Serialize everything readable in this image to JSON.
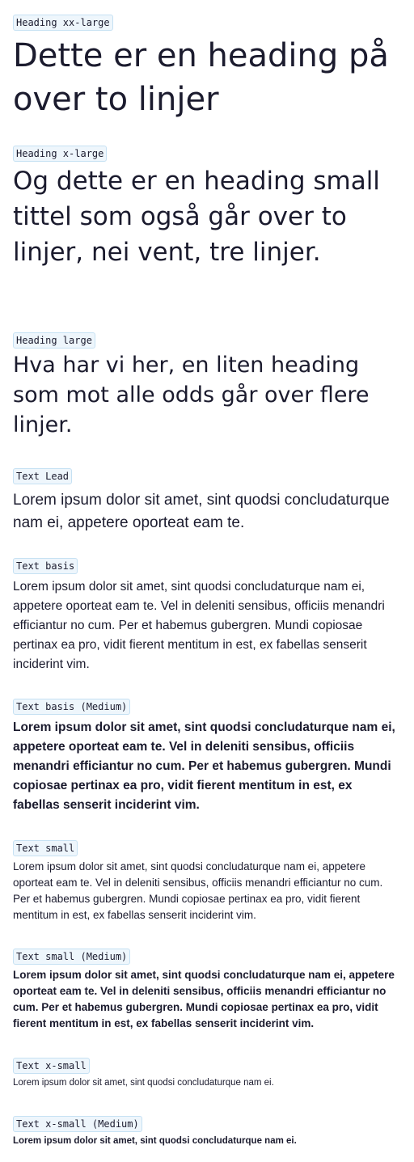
{
  "samples": {
    "heading_xxl": {
      "tag": "Heading xx-large",
      "text": "Dette er en heading på over to linjer"
    },
    "heading_xl": {
      "tag": "Heading x-large",
      "text": "Og dette er en heading small tittel som også går over to linjer, nei vent, tre linjer."
    },
    "heading_large": {
      "tag": "Heading large",
      "text": "Hva har vi her, en liten heading som mot alle odds går over flere linjer."
    },
    "text_lead": {
      "tag": "Text Lead",
      "text": "Lorem ipsum dolor sit amet, sint quodsi concludaturque nam ei, appetere oporteat eam te."
    },
    "text_basis": {
      "tag": "Text basis",
      "text": "Lorem ipsum dolor sit amet, sint quodsi concludaturque nam ei, appetere oporteat eam te. Vel in deleniti sensibus, officiis menandri efficiantur no cum. Per et habemus gubergren. Mundi copiosae pertinax ea pro, vidit fierent mentitum in est, ex fabellas senserit inciderint vim."
    },
    "text_basis_medium": {
      "tag": "Text basis (Medium)",
      "text": "Lorem ipsum dolor sit amet, sint quodsi concludaturque nam ei, appetere oporteat eam te. Vel in deleniti sensibus, officiis menandri efficiantur no cum. Per et habemus gubergren. Mundi copiosae pertinax ea pro, vidit fierent mentitum in est, ex fabellas senserit inciderint vim."
    },
    "text_small": {
      "tag": "Text small",
      "text": "Lorem ipsum dolor sit amet, sint quodsi concludaturque nam ei, appetere oporteat eam te. Vel in deleniti sensibus, officiis menandri efficiantur no cum. Per et habemus gubergren. Mundi copiosae pertinax ea pro, vidit fierent mentitum in est, ex fabellas senserit inciderint vim."
    },
    "text_small_medium": {
      "tag": "Text small (Medium)",
      "text": "Lorem ipsum dolor sit amet, sint quodsi concludaturque nam ei, appetere oporteat eam te. Vel in deleniti sensibus, officiis menandri efficiantur no cum. Per et habemus gubergren. Mundi copiosae pertinax ea pro, vidit fierent mentitum in est, ex fabellas senserit inciderint vim."
    },
    "text_xsmall": {
      "tag": "Text x-small",
      "text": "Lorem ipsum dolor sit amet, sint quodsi concludaturque nam ei."
    },
    "text_xsmall_medium": {
      "tag": "Text x-small (Medium)",
      "text": "Lorem ipsum dolor sit amet, sint quodsi concludaturque nam ei."
    }
  },
  "colors": {
    "text": "#1b1b2e",
    "tag_background": "#eef6fc",
    "tag_border": "#c6e1f3"
  }
}
